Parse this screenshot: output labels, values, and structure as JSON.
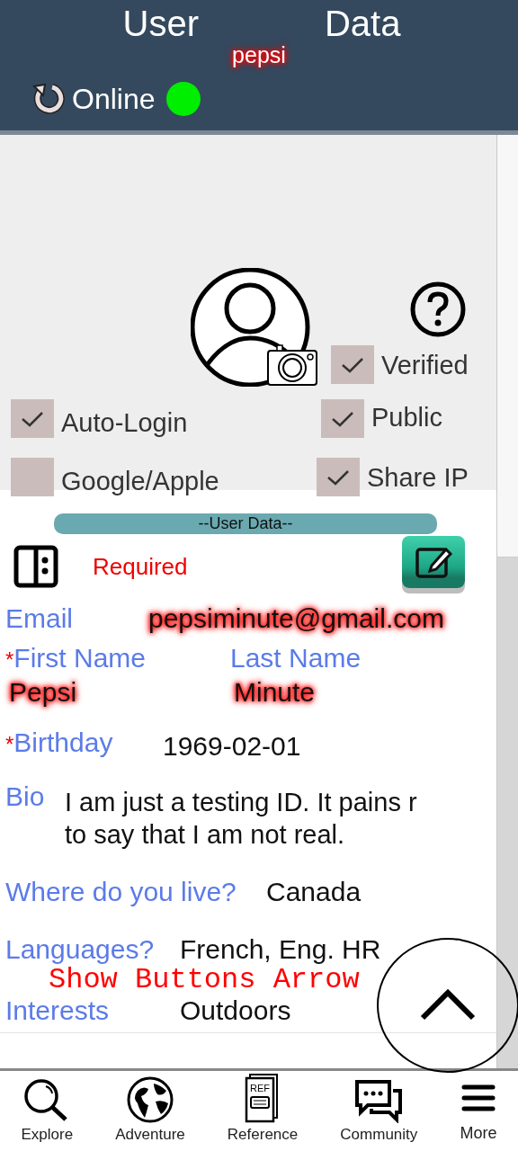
{
  "header": {
    "title_words": [
      "User",
      "Data"
    ],
    "username": "pepsi",
    "username_redacted": true,
    "status": {
      "label": "Online",
      "online": true
    }
  },
  "profile": {
    "checkboxes": [
      {
        "label": "Verified",
        "checked": true
      },
      {
        "label": "Auto-Login",
        "checked": true
      },
      {
        "label": "Public",
        "checked": true
      },
      {
        "label": "Google/Apple",
        "checked": false
      },
      {
        "label": "Share IP",
        "checked": true
      }
    ]
  },
  "section_title": "--User Data--",
  "required_label": "Required",
  "fields": [
    {
      "kind": "single",
      "label": "Email",
      "value": "pepsiminute@gmail.com",
      "redacted": true
    },
    {
      "kind": "names",
      "items": [
        {
          "label": "First Name",
          "marker": "*",
          "value": "Pepsi",
          "redacted": true
        },
        {
          "label": "Last Name",
          "value": "Minute",
          "redacted": true
        }
      ]
    },
    {
      "kind": "single",
      "label": "Birthday",
      "marker": "*",
      "value": "1969-02-01"
    },
    {
      "kind": "bio",
      "label": "Bio",
      "lines": [
        "I am just a testing ID. It pains r",
        "to say that I am not real."
      ]
    },
    {
      "kind": "single",
      "label": "Where do you live?",
      "value": "Canada"
    },
    {
      "kind": "single",
      "label": "Languages?",
      "value": "French, Eng. HR"
    },
    {
      "kind": "note",
      "text": "Show Buttons Arrow"
    },
    {
      "kind": "single",
      "label": "Interests",
      "value": "Outdoors"
    }
  ],
  "nav": [
    {
      "kind": "search",
      "label": "Explore"
    },
    {
      "kind": "globe",
      "label": "Adventure"
    },
    {
      "kind": "book",
      "label": "Reference",
      "icon_text": "REF"
    },
    {
      "kind": "chat",
      "label": "Community"
    },
    {
      "kind": "menu",
      "label": "More"
    }
  ]
}
